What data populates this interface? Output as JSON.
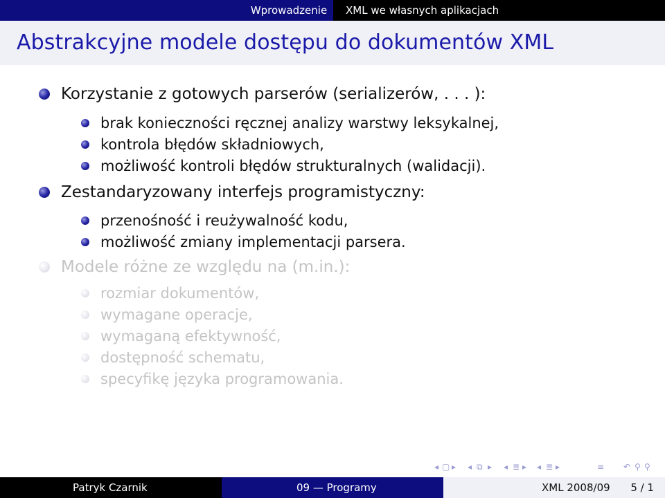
{
  "header": {
    "section_1": "Wprowadzenie",
    "section_2": "XML we własnych aplikacjach"
  },
  "frame_title": "Abstrakcyjne modele dostępu do dokumentów XML",
  "items": [
    {
      "text": "Korzystanie z gotowych parserów (serializerów, . . . ):",
      "sub": [
        "brak konieczności ręcznej analizy warstwy leksykalnej,",
        "kontrola błędów składniowych,",
        "możliwość kontroli błędów strukturalnych (walidacji)."
      ]
    },
    {
      "text": "Zestandaryzowany interfejs programistyczny:",
      "sub": [
        "przenośność i reużywalność kodu,",
        "możliwość zmiany implementacji parsera."
      ]
    },
    {
      "text": "Modele różne ze względu na (m.in.):",
      "sub": [
        "rozmiar dokumentów,",
        "wymagane operacje,",
        "wymaganą efektywność,",
        "dostępność schematu,",
        "specyfikę języka programowania."
      ]
    }
  ],
  "nav_icons": [
    "frame-back-icon",
    "frame-forward-icon",
    "subsection-back-icon",
    "subsection-forward-icon",
    "section-back-icon",
    "section-forward-icon",
    "appendix-icon",
    "search-icon"
  ],
  "footer": {
    "author": "Patryk Czarnik",
    "talk": "09 — Programy",
    "date": "XML 2008/09",
    "page": "5 / 1"
  },
  "colors": {
    "header_bg": "#0d0d80",
    "title_color": "#1a1aaa",
    "title_band": "#f0f0f7",
    "dimmed_text": "#c4c4c4"
  }
}
